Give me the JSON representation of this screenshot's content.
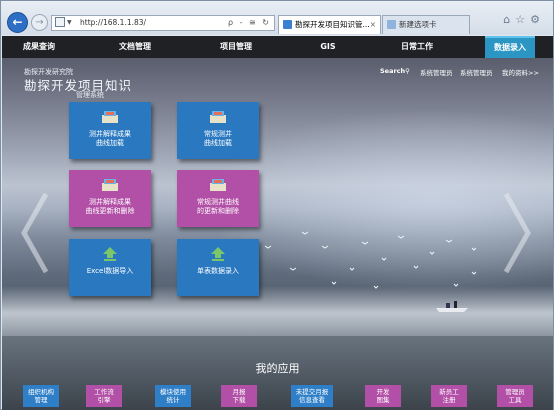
{
  "browser": {
    "url": "http://168.1.1.83/",
    "tabs": [
      {
        "label": "勘探开发项目知识管...",
        "active": true
      },
      {
        "label": "新建选项卡",
        "active": false
      }
    ],
    "address_tools": "ρ - ≅ ↻"
  },
  "topnav": {
    "items": [
      "成果查询",
      "文档管理",
      "项目管理",
      "GIS",
      "日常工作",
      "数据录入"
    ],
    "active_index": 5
  },
  "brand": {
    "line1": "勘探开发研究院",
    "line2": "勘探开发项目知识",
    "line3": "管理系统"
  },
  "user_links": {
    "search": "Search",
    "user1": "系统管理员",
    "user2": "系统管理员",
    "profile": "我的资料>>"
  },
  "tiles": [
    {
      "label": "测井解释成果\n曲线加载",
      "color": "#2a78c0",
      "icon": "books-icon"
    },
    {
      "label": "常规测井\n曲线加载",
      "color": "#2a78c0",
      "icon": "books-icon"
    },
    {
      "label": "测井解释成果\n曲线更新和删除",
      "color": "#b24fa6",
      "icon": "books-icon"
    },
    {
      "label": "常规测井曲线\n的更新和删除",
      "color": "#b24fa6",
      "icon": "books-icon"
    },
    {
      "label": "Excel数据导入",
      "color": "#2a78c0",
      "icon": "upload-icon"
    },
    {
      "label": "单表数据录入",
      "color": "#2a78c0",
      "icon": "upload-icon"
    }
  ],
  "apps": {
    "title": "我的应用",
    "items": [
      {
        "label": "组织机构\n管理",
        "color": "#2f7fc8"
      },
      {
        "label": "工作流\n引擎",
        "color": "#b24fa6"
      },
      {
        "label": "模块使用\n统计",
        "color": "#2f7fc8"
      },
      {
        "label": "月报\n下载",
        "color": "#b24fa6"
      },
      {
        "label": "未提交月报\n信息查看",
        "color": "#2f7fc8"
      },
      {
        "label": "开发\n图集",
        "color": "#b24fa6"
      },
      {
        "label": "新员工\n注册",
        "color": "#b24fa6"
      },
      {
        "label": "管理员\n工具",
        "color": "#b24fa6"
      }
    ]
  },
  "colors": {
    "nav_active": "#2b95c4",
    "tile_blue": "#2a78c0",
    "tile_magenta": "#b24fa6"
  }
}
